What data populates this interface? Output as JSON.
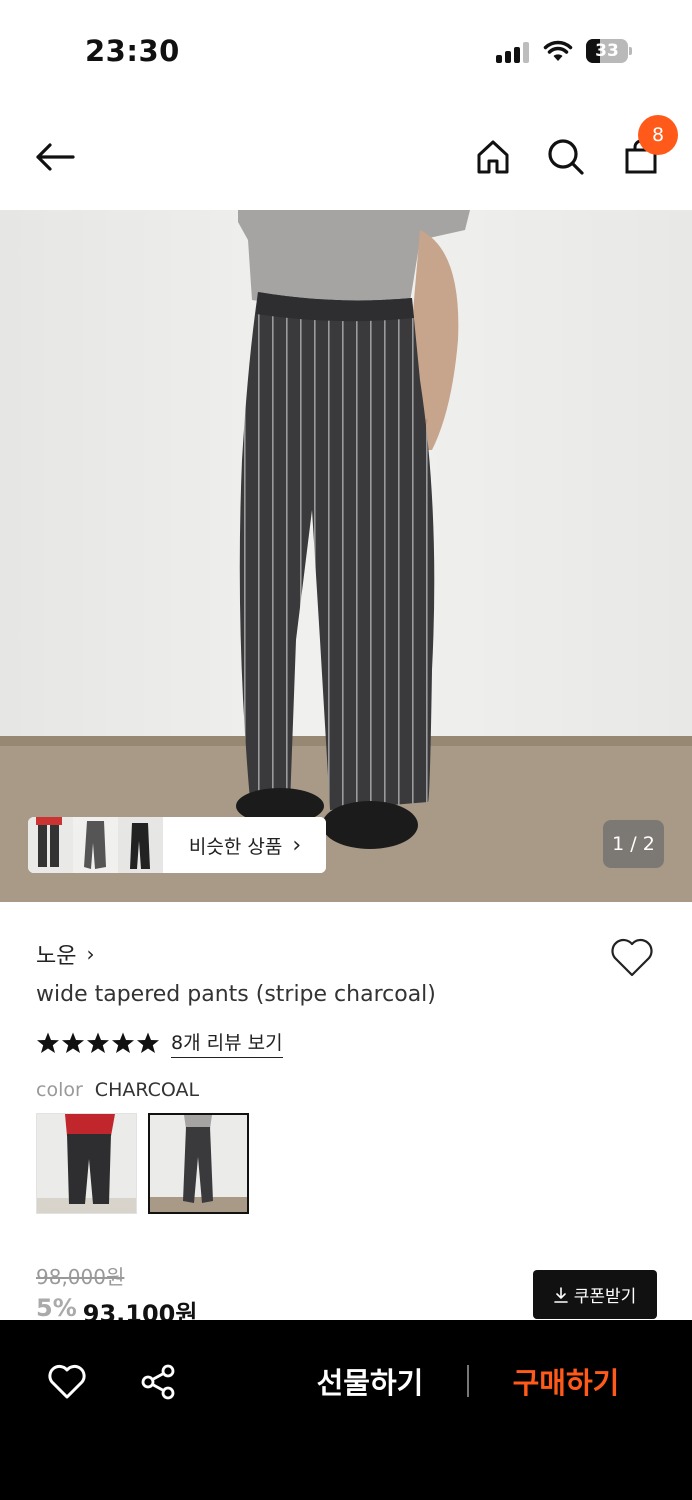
{
  "status_bar": {
    "time": "23:30",
    "battery_level": "33",
    "icons": [
      "signal-icon",
      "wifi-icon",
      "battery-icon"
    ]
  },
  "nav": {
    "icons": [
      "back-arrow-icon",
      "home-icon",
      "search-icon",
      "shopping-bag-icon"
    ],
    "cart_count": "8"
  },
  "hero": {
    "page_indicator": "1 / 2",
    "similar_label": "비슷한 상품"
  },
  "product": {
    "brand": "노운",
    "title": "wide tapered pants (stripe charcoal)",
    "rating_stars": 5,
    "review_link": "8개 리뷰 보기",
    "color_label": "color",
    "color_value": "CHARCOAL",
    "original_price": "98,000원",
    "discount": "5%",
    "price": "93,100원",
    "coupon_label": "쿠폰받기"
  },
  "bottom_bar": {
    "gift_label": "선물하기",
    "buy_label": "구매하기"
  },
  "colors": {
    "accent": "#ff5a1a",
    "bottom_bar_bg": "#000000"
  }
}
